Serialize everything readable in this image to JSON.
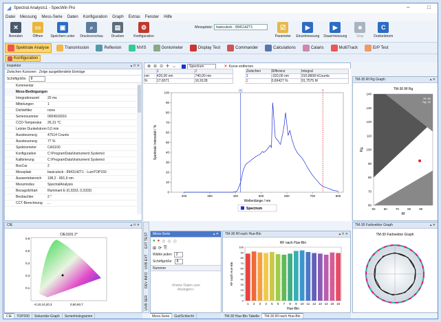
{
  "window": {
    "title": "Spectral Analysis1 - SpecWin Pro",
    "minimize": "–",
    "maximize": "□"
  },
  "menu": [
    "Datei",
    "Messung",
    "Mess-Serie",
    "Daten",
    "Konfiguration",
    "Graph",
    "Extras",
    "Fenster",
    "Hilfe"
  ],
  "ribbon": {
    "buttons": [
      {
        "label": "Beenden",
        "icon": "close-icon",
        "color": "#4a5a6c"
      },
      {
        "label": "Öffnen",
        "icon": "folder-icon",
        "color": "#e9b53b"
      },
      {
        "label": "Speichern unter",
        "icon": "save-icon",
        "color": "#2c6cc4"
      },
      {
        "label": "Druckvorschau",
        "icon": "print-preview-icon",
        "color": "#5c7c9c"
      },
      {
        "label": "Drucken",
        "icon": "printer-icon",
        "color": "#5c6c7c"
      },
      {
        "label": "Konfiguration",
        "icon": "config-icon",
        "color": "#c0392b"
      }
    ],
    "messplatz_label": "Messplatz:",
    "messplatz_value": "basiculock - 894114ZT1",
    "right_buttons": [
      {
        "label": "Parameter",
        "icon": "parameter-icon",
        "color": "#e6b84a"
      },
      {
        "label": "Einzelmessung",
        "icon": "single-measure-icon",
        "color": "#2c6cc4"
      },
      {
        "label": "Dauermessung",
        "icon": "continuous-measure-icon",
        "color": "#2c6cc4"
      },
      {
        "label": "Stop",
        "icon": "stop-icon",
        "color": "#aab4c0"
      },
      {
        "label": "Dunkelstrom",
        "icon": "darkcurrent-icon",
        "color": "#2c6cc4"
      }
    ]
  },
  "modes": [
    {
      "label": "Spektrale Analyse",
      "color": "#e55",
      "active": true
    },
    {
      "label": "Transmission",
      "color": "#f2b84a",
      "active": false
    },
    {
      "label": "Reflexion",
      "color": "#59a",
      "active": false
    },
    {
      "label": "NVIS",
      "color": "#3c9",
      "active": false
    },
    {
      "label": "Goniometer",
      "color": "#8a8",
      "active": false
    },
    {
      "label": "Display Test",
      "color": "#c33",
      "active": false
    },
    {
      "label": "Commander",
      "color": "#c55",
      "active": false
    },
    {
      "label": "Calculations",
      "color": "#57a",
      "active": false
    },
    {
      "label": "Calaris",
      "color": "#c8a",
      "active": false
    },
    {
      "label": "MultiTrack",
      "color": "#e55",
      "active": false
    },
    {
      "label": "ErP Test",
      "color": "#e96",
      "active": false
    }
  ],
  "toolbar3": {
    "konfig_label": "Konfiguration"
  },
  "inspector": {
    "title": "Inspektor",
    "toggle_label": "Zwischen Kursoren",
    "show_hidden_label": "Zeige ausgeblendete Einträge",
    "font_label": "Schriftgröße:",
    "font_value": "8",
    "rows": [
      {
        "k": "Kommentar",
        "v": "",
        "sec": false
      },
      {
        "k": "Mess-Bedingungen",
        "v": "",
        "sec": true
      },
      {
        "k": "Integrationszeit",
        "v": "20 ms",
        "sec": false
      },
      {
        "k": "Mittelungen",
        "v": "1",
        "sec": false
      },
      {
        "k": "Dichtefilter",
        "v": "none",
        "sec": false
      },
      {
        "k": "Seriennummer",
        "v": "0004910016",
        "sec": false
      },
      {
        "k": "CCD-Temperatur",
        "v": "26,31 °C",
        "sec": false
      },
      {
        "k": "Letzter Dunkelstrom",
        "v": "0,0 min",
        "sec": false
      },
      {
        "k": "Aussteuerung",
        "v": "47514 Counts",
        "sec": false
      },
      {
        "k": "Aussteuerung",
        "v": "77 %",
        "sec": false
      },
      {
        "k": "Spektrometer",
        "v": "CAS100",
        "sec": false
      },
      {
        "k": "Konfiguration",
        "v": "C:\\ProgramData\\Instrument Systems\\",
        "sec": false
      },
      {
        "k": "Kalibrierung",
        "v": "C:\\ProgramData\\Instrument Systems\\",
        "sec": false
      },
      {
        "k": "BoxCar",
        "v": "2",
        "sec": false
      },
      {
        "k": "Messplatz",
        "v": "basiculock - 894114ZT1 - LumTOP150",
        "sec": false
      },
      {
        "k": "Auswertebereich",
        "v": "198,2 - 801,9 nm",
        "sec": false
      },
      {
        "k": "Messmodus",
        "v": "SpectralAnalysis",
        "sec": false
      },
      {
        "k": "Bezugslichtart",
        "v": "Illuminant E (0,3333, 0,3333)",
        "sec": false
      },
      {
        "k": "Beobachter",
        "v": "2 °",
        "sec": false
      },
      {
        "k": "CCT-Berechnung",
        "v": "...",
        "sec": false
      }
    ]
  },
  "spectrum": {
    "toolbar": {
      "spectrum_label": "Spectrum",
      "curve_label": "Kurve entfernen"
    },
    "table": {
      "headers": [
        "",
        "1",
        "2"
      ],
      "rows": [
        [
          "nm",
          "420,00 nm",
          "740,00 nm"
        ],
        [
          "%",
          "17,6071",
          "16,9128"
        ]
      ]
    },
    "diff_table": {
      "headers": [
        "Zwischen",
        "Differenz",
        "Integral"
      ],
      "rows": [
        [
          "1",
          "-320,00 nm",
          "310,8608 kCounts"
        ],
        [
          "2",
          "0,69427 %",
          "91,7575 M"
        ]
      ]
    },
    "ylabel": "Spektrale Intensität / %",
    "xlabel": "Wellenlänge / nm",
    "legend": "Spectrum",
    "cursor1": "(1)",
    "cursor2": "2"
  },
  "rfrg": {
    "title": "TM-30 Rf Rg Graph",
    "graph_title": "TM-30 Rf Rg",
    "ylabel": "Rg",
    "xlabel": "Rf",
    "note1": "Rf: 89",
    "note2": "Rg: 92"
  },
  "cie": {
    "title": "CIE",
    "graph_title": "CIE1931 2°"
  },
  "mess_serie": {
    "title": "Mess-Serie",
    "show_label": "Wähle jeden",
    "show_value": "2",
    "font_label": "Schriftgröße:",
    "font_value": "8",
    "col": "Nummer",
    "empty": "<Keine Daten zum Anzeigen>"
  },
  "hue": {
    "title": "TM-30 Rf nach Hue-Bin",
    "graph_title": "RF nach Hue-Bin",
    "ylabel": "RF nach Hue-Bin",
    "xlabel": "Hue-Bin"
  },
  "farbvektor": {
    "title": "TM-30 Farbvektor Graph",
    "graph_title": "TM-30 Farbvektor Graph"
  },
  "bottom_tabs": {
    "left": [
      "CIE",
      "TOP200",
      "Sekundär-Graph",
      "Serienhistogramm"
    ],
    "mid": [
      "Mess-Serie",
      "Gut/Schlecht"
    ],
    "right": [
      "TM-30 Hue-Bin Tabelle",
      "TM-30 Rf nach Hue-Bin"
    ]
  },
  "side_tabs": [
    "EXT TEST",
    "UVB EXT",
    "DEV INFO",
    "UVB SER"
  ],
  "chart_data": [
    {
      "type": "line",
      "title": "",
      "xlabel": "Wellenlänge / nm",
      "ylabel": "Spektrale Intensität / %",
      "xlim": [
        150,
        820
      ],
      "ylim": [
        0,
        100
      ],
      "xticks": [
        200,
        300,
        400,
        500,
        600,
        700,
        800
      ],
      "yticks": [
        0,
        10,
        20,
        30,
        40,
        50,
        60,
        70,
        80,
        90,
        100
      ],
      "series": [
        {
          "name": "Spectrum",
          "x": [
            198,
            390,
            405,
            410,
            420,
            430,
            440,
            450,
            465,
            480,
            495,
            505,
            510,
            520,
            535,
            540,
            545,
            555,
            565,
            575,
            585,
            590,
            595,
            605,
            612,
            620,
            630,
            640,
            650,
            660,
            670,
            680,
            690,
            700,
            710,
            720,
            730,
            740,
            760,
            780,
            801
          ],
          "y": [
            0,
            0,
            1,
            3,
            10,
            22,
            28,
            30,
            33,
            36,
            38,
            41,
            40,
            42,
            47,
            45,
            90,
            55,
            52,
            48,
            60,
            68,
            80,
            57,
            62,
            53,
            45,
            40,
            37,
            34,
            30,
            25,
            21,
            17,
            14,
            11,
            8,
            6,
            4,
            2,
            1
          ]
        }
      ]
    },
    {
      "type": "bar",
      "title": "RF nach Hue-Bin",
      "xlabel": "Hue-Bin",
      "ylabel": "RF nach Hue-Bin",
      "ylim": [
        0,
        100
      ],
      "yticks": [
        0,
        10,
        20,
        30,
        40,
        50,
        60,
        70,
        80,
        90,
        100
      ],
      "categories": [
        "1",
        "2",
        "3",
        "4",
        "5",
        "6",
        "7",
        "8",
        "9",
        "10",
        "11",
        "12",
        "13",
        "14",
        "15",
        "16"
      ],
      "values": [
        88,
        92,
        90,
        89,
        91,
        87,
        86,
        88,
        93,
        94,
        91,
        89,
        88,
        86,
        90,
        89
      ],
      "colors": [
        "#e8443a",
        "#ef6a3a",
        "#f3a23b",
        "#f2c84a",
        "#c9c94a",
        "#9fcc4d",
        "#5fb95a",
        "#3fae83",
        "#3aaeb6",
        "#3d95cf",
        "#4e77c6",
        "#6260b8",
        "#8b5bb5",
        "#b85fae",
        "#d95a95",
        "#e64b68"
      ]
    },
    {
      "type": "scatter",
      "title": "TM-30 Rf Rg",
      "xlabel": "Rf",
      "ylabel": "Rg",
      "xlim": [
        50,
        100
      ],
      "ylim": [
        60,
        140
      ],
      "xticks": [
        50,
        60,
        70,
        80,
        90
      ],
      "yticks": [
        60,
        70,
        80,
        90,
        100,
        110,
        120,
        130,
        140
      ],
      "series": [
        {
          "x": [
            89
          ],
          "y": [
            92
          ]
        }
      ]
    }
  ]
}
